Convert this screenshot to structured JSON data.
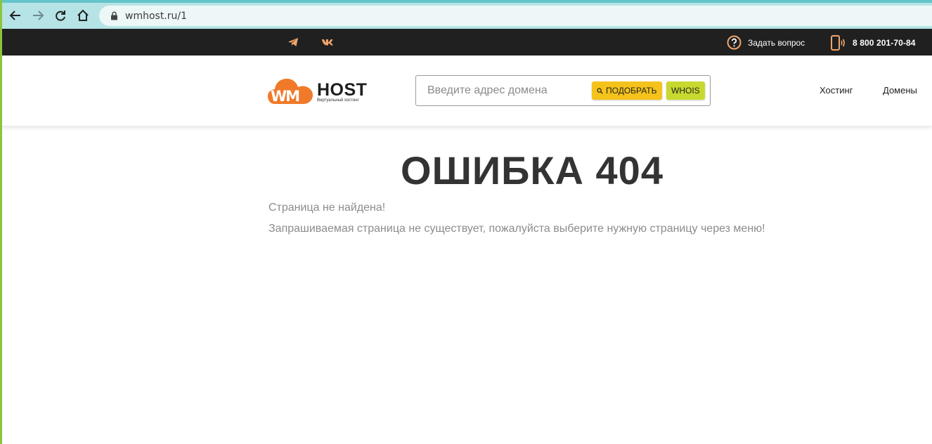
{
  "browser": {
    "url": "wmhost.ru/1",
    "icons": [
      "back-arrow-icon",
      "forward-arrow-icon",
      "reload-icon",
      "home-icon",
      "lock-icon"
    ]
  },
  "topbar": {
    "social_icons": [
      "telegram-icon",
      "vk-icon"
    ],
    "help_text": "Задать вопрос",
    "phone": "8 800 201-70-84",
    "accent_color": "#f0a56b"
  },
  "header": {
    "logo": {
      "mark": "WM",
      "text": "HOST",
      "subtitle": "Виртуальный хостинг",
      "color": "#f07a2a"
    },
    "search": {
      "placeholder": "Введите адрес домена",
      "value": "",
      "pick_label": "ПОДОБРАТЬ",
      "whois_label": "WHOIS"
    },
    "menu": [
      {
        "label": "Хостинг"
      },
      {
        "label": "Домены"
      }
    ]
  },
  "content": {
    "title": "ОШИБКА 404",
    "line1": "Страница не найдена!",
    "line2": "Запрашиваемая страница не существует, пожалуйста выберите нужную страницу через меню!"
  }
}
